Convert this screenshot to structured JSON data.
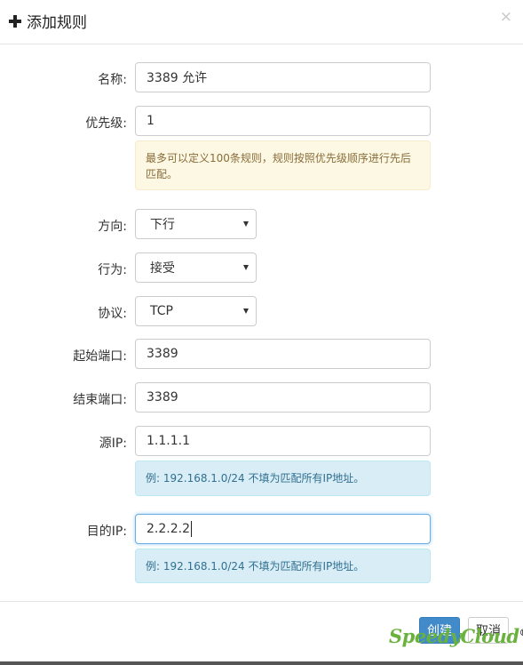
{
  "header": {
    "title": "添加规则",
    "close_symbol": "×"
  },
  "form": {
    "name": {
      "label": "名称:",
      "value": "3389 允许"
    },
    "priority": {
      "label": "优先级:",
      "value": "1",
      "hint": "最多可以定义100条规则，规则按照优先级顺序进行先后匹配。"
    },
    "direction": {
      "label": "方向:",
      "selected": "下行"
    },
    "action": {
      "label": "行为:",
      "selected": "接受"
    },
    "protocol": {
      "label": "协议:",
      "selected": "TCP"
    },
    "start_port": {
      "label": "起始端口:",
      "value": "3389"
    },
    "end_port": {
      "label": "结束端口:",
      "value": "3389"
    },
    "source_ip": {
      "label": "源IP:",
      "value": "1.1.1.1",
      "hint": "例: 192.168.1.0/24 不填为匹配所有IP地址。"
    },
    "dest_ip": {
      "label": "目的IP:",
      "value": "2.2.2.2",
      "hint": "例: 192.168.1.0/24 不填为匹配所有IP地址。"
    }
  },
  "footer": {
    "create_label": "创建",
    "cancel_label": "取消"
  },
  "watermark": {
    "text": "SpeedyCloud",
    "reg": "®"
  },
  "colors": {
    "primary": "#428bca",
    "warning_bg": "#fcf8e3",
    "info_bg": "#d9edf7",
    "watermark": "#6ab23e"
  }
}
